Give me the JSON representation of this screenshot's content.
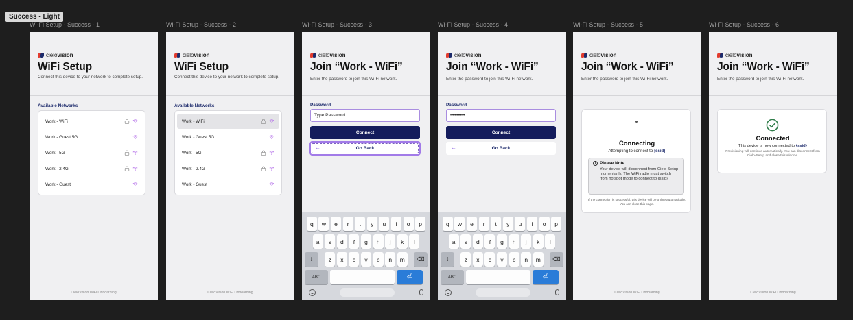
{
  "canvas": {
    "section_label": "Success - Light"
  },
  "brand": {
    "logo_prefix": "cielo",
    "logo_suffix": "vision"
  },
  "colors": {
    "accent": "#1c2a6b",
    "button": "#141c5c",
    "focus": "#a27be8",
    "success": "#2f7d4a"
  },
  "footer_text": "CieloVision WiFi Onboarding",
  "artboards": [
    {
      "title": "Wi-Fi Setup - Success - 1",
      "heading": "WiFi Setup",
      "subtitle": "Connect this device to your network to complete setup.",
      "networks_heading": "Available Networks",
      "networks": [
        {
          "name": "Work - WiFi",
          "locked": true
        },
        {
          "name": "Work - Guest 5G",
          "locked": false
        },
        {
          "name": "Work - 5G",
          "locked": true
        },
        {
          "name": "Work - 2.4G",
          "locked": true
        },
        {
          "name": "Work - Guest",
          "locked": false
        }
      ]
    },
    {
      "title": "Wi-Fi Setup - Success - 2",
      "heading": "WiFi Setup",
      "subtitle": "Connect this device to your network to complete setup.",
      "networks_heading": "Available Networks",
      "selected": "Work - WiFi",
      "networks": [
        {
          "name": "Work - WiFi",
          "locked": true
        },
        {
          "name": "Work - Guest 5G",
          "locked": false
        },
        {
          "name": "Work - 5G",
          "locked": true
        },
        {
          "name": "Work - 2.4G",
          "locked": true
        },
        {
          "name": "Work - Guest",
          "locked": false
        }
      ]
    },
    {
      "title": "Wi-Fi Setup - Success - 3",
      "heading": "Join “Work - WiFi”",
      "subtitle": "Enter the password to join this Wi-Fi network.",
      "password_label": "Password",
      "password_value": "Type Password |",
      "connect_label": "Connect",
      "back_label": "Go Back"
    },
    {
      "title": "Wi-Fi Setup - Success - 4",
      "heading": "Join “Work - WiFi”",
      "subtitle": "Enter the password to join this Wi-Fi network.",
      "password_label": "Password",
      "password_value": "•••••••••••••",
      "connect_label": "Connect",
      "back_label": "Go Back"
    },
    {
      "title": "Wi-Fi Setup - Success - 5",
      "heading": "Join “Work - WiFi”",
      "subtitle": "Enter the password to join this Wi-Fi network.",
      "status_title": "Connecting",
      "status_sub_prefix": "Attempting to connect to",
      "ssid": "{ssid}",
      "note_title": "Please Note",
      "note_body": "Your device will disconnect from Cielo-Setup momentarily. The WiFi radio must switch from hotspot mode to connect to {ssid}",
      "card_footer": "If the connection is successful, this device will be online automatically. You can close this page."
    },
    {
      "title": "Wi-Fi Setup - Success - 6",
      "heading": "Join “Work - WiFi”",
      "subtitle": "Enter the password to join this Wi-Fi network.",
      "status_title": "Connected",
      "status_sub_prefix": "This device is now connected to",
      "ssid": "{ssid}",
      "status_sub2": "Provisioning will continue automatically. You can disconnect from Cielo-Setup and close this window."
    }
  ],
  "keyboard": {
    "row1": [
      "q",
      "w",
      "e",
      "r",
      "t",
      "y",
      "u",
      "i",
      "o",
      "p"
    ],
    "row2": [
      "a",
      "s",
      "d",
      "f",
      "g",
      "h",
      "j",
      "k",
      "l"
    ],
    "row3": [
      "z",
      "x",
      "c",
      "v",
      "b",
      "n",
      "m"
    ],
    "shift": "⇧",
    "delete": "⌫",
    "abc": "ABC",
    "return": "⏎"
  }
}
